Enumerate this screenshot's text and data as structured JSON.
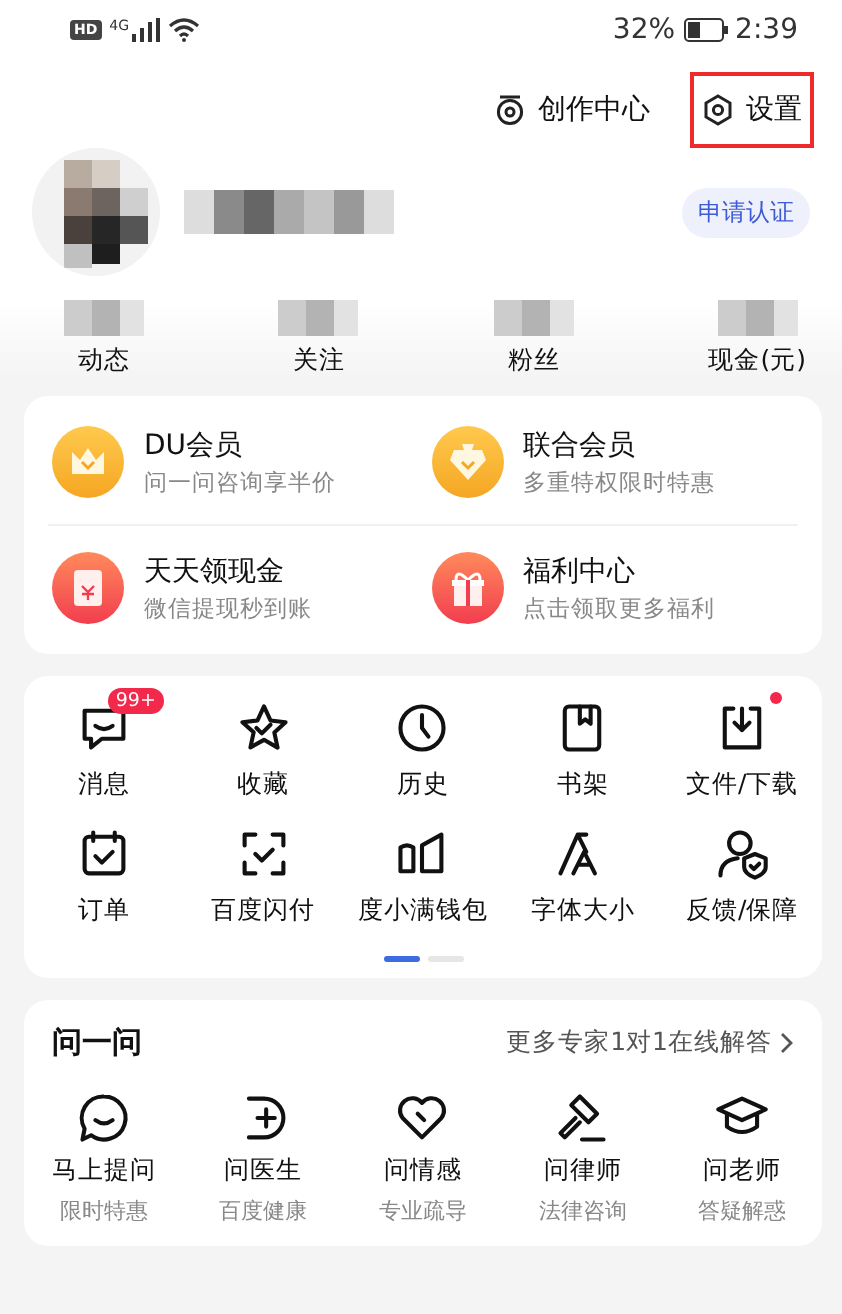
{
  "status_bar": {
    "hd": "HD",
    "network": "4G",
    "battery": "32%",
    "time": "2:39"
  },
  "header_actions": [
    {
      "kind": "creator",
      "label": "创作中心",
      "highlighted": false
    },
    {
      "kind": "settings",
      "label": "设置",
      "highlighted": true
    }
  ],
  "profile": {
    "verify_button": "申请认证"
  },
  "stats": [
    {
      "label": "动态"
    },
    {
      "label": "关注"
    },
    {
      "label": "粉丝"
    },
    {
      "label": "现金(元)"
    }
  ],
  "memberships": [
    {
      "kind": "crown",
      "title": "DU会员",
      "subtitle": "问一问咨询享半价"
    },
    {
      "kind": "badge",
      "title": "联合会员",
      "subtitle": "多重特权限时特惠"
    },
    {
      "kind": "envelope",
      "title": "天天领现金",
      "subtitle": "微信提现秒到账"
    },
    {
      "kind": "gift",
      "title": "福利中心",
      "subtitle": "点击领取更多福利"
    }
  ],
  "tools": [
    {
      "kind": "message",
      "label": "消息",
      "badge": "99+",
      "dot": false
    },
    {
      "kind": "star",
      "label": "收藏",
      "dot": false
    },
    {
      "kind": "clock",
      "label": "历史",
      "dot": false
    },
    {
      "kind": "book",
      "label": "书架",
      "dot": false
    },
    {
      "kind": "download",
      "label": "文件/下载",
      "dot": true
    },
    {
      "kind": "calendar",
      "label": "订单",
      "dot": false
    },
    {
      "kind": "scan",
      "label": "百度闪付",
      "dot": false
    },
    {
      "kind": "wallet",
      "label": "度小满钱包",
      "dot": false
    },
    {
      "kind": "font",
      "label": "字体大小",
      "dot": false
    },
    {
      "kind": "shield",
      "label": "反馈/保障",
      "dot": false
    }
  ],
  "pager": [
    {
      "selected": true
    },
    {
      "selected": false
    }
  ],
  "ask": {
    "title": "问一问",
    "more": "更多专家1对1在线解答",
    "items": [
      {
        "kind": "chat",
        "title": "马上提问",
        "subtitle": "限时特惠"
      },
      {
        "kind": "medical",
        "title": "问医生",
        "subtitle": "百度健康"
      },
      {
        "kind": "heart",
        "title": "问情感",
        "subtitle": "专业疏导"
      },
      {
        "kind": "gavel",
        "title": "问律师",
        "subtitle": "法律咨询"
      },
      {
        "kind": "cap",
        "title": "问老师",
        "subtitle": "答疑解惑"
      }
    ]
  }
}
